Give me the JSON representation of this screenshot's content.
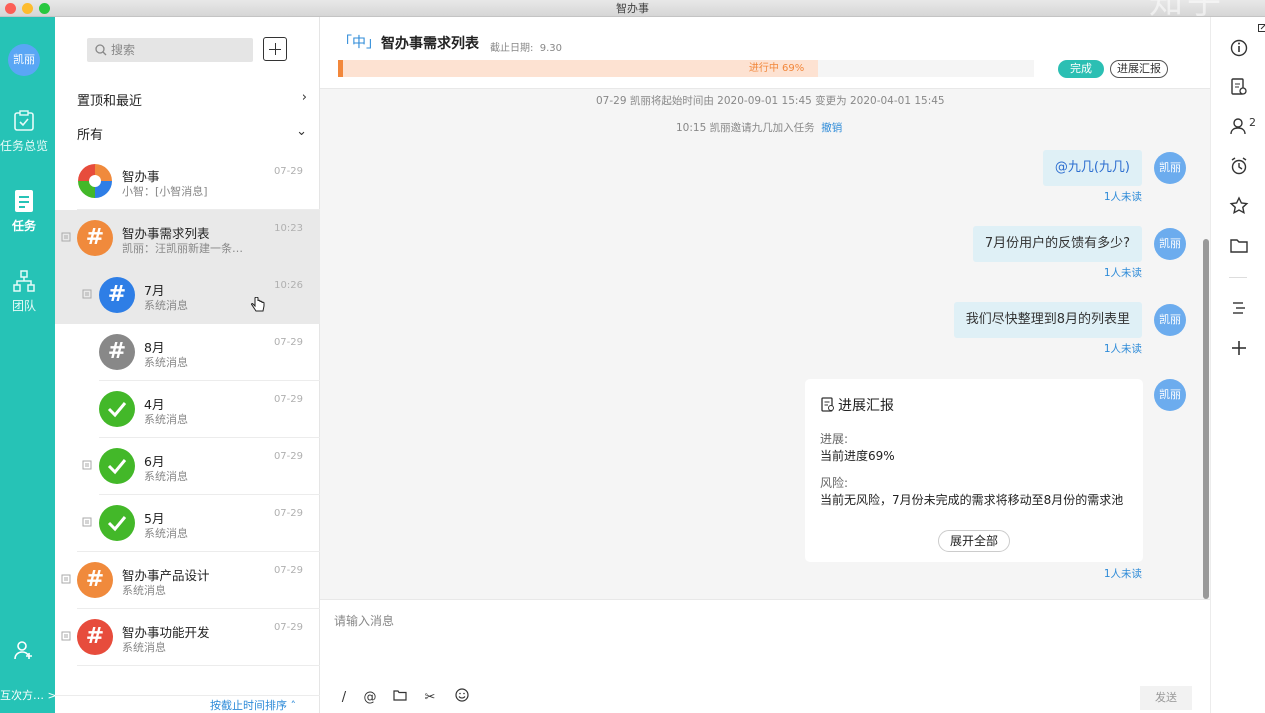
{
  "window": {
    "title": "智办事",
    "watermark": "知乎"
  },
  "nav": {
    "avatar": "凯丽",
    "items": [
      {
        "label": "任务总览",
        "icon": "task-overview-icon"
      },
      {
        "label": "任务",
        "icon": "task-icon"
      },
      {
        "label": "团队",
        "icon": "team-icon"
      }
    ],
    "bottom_label": "互次方…"
  },
  "list": {
    "search_placeholder": "搜索",
    "section_pinned": "置顶和最近",
    "section_all": "所有",
    "sort_label": "按截止时间排序",
    "items": [
      {
        "name": "智办事",
        "sub": "小智：[小智消息]",
        "time": "07-29",
        "color": "logo"
      },
      {
        "name": "智办事需求列表",
        "sub": "凯丽：汪凯丽新建一条…",
        "time": "10:23",
        "color": "#f08a3c"
      },
      {
        "name": "7月",
        "sub": "系统消息",
        "time": "10:26",
        "color": "#2e7ee6"
      },
      {
        "name": "8月",
        "sub": "系统消息",
        "time": "07-29",
        "color": "#888888"
      },
      {
        "name": "4月",
        "sub": "系统消息",
        "time": "07-29",
        "color": "#43b829"
      },
      {
        "name": "6月",
        "sub": "系统消息",
        "time": "07-29",
        "color": "#43b829"
      },
      {
        "name": "5月",
        "sub": "系统消息",
        "time": "07-29",
        "color": "#43b829"
      },
      {
        "name": "智办事产品设计",
        "sub": "系统消息",
        "time": "07-29",
        "color": "#f08a3c"
      },
      {
        "name": "智办事功能开发",
        "sub": "系统消息",
        "time": "07-29",
        "color": "#e74c3c"
      }
    ]
  },
  "chat": {
    "priority": "「中」",
    "title": "智办事需求列表",
    "deadline_label": "截止日期:",
    "deadline_value": "9.30",
    "progress_label": "进行中 69%",
    "progress_value": 0.69,
    "btn_done": "完成",
    "btn_report": "进展汇报",
    "system_messages": [
      {
        "text": "07-29  凯丽将起始时间由 2020-09-01 15:45 变更为 2020-04-01 15:45"
      },
      {
        "text": "10:15  凯丽邀请九几加入任务",
        "link": "撤销"
      }
    ],
    "messages": [
      {
        "text": "@九几(九几)",
        "avatar": "凯丽",
        "status": "1人未读"
      },
      {
        "text": "7月份用户的反馈有多少?",
        "avatar": "凯丽",
        "status": "1人未读"
      },
      {
        "text": "我们尽快整理到8月的列表里",
        "avatar": "凯丽",
        "status": "1人未读"
      }
    ],
    "report_card": {
      "title": "进展汇报",
      "progress_key": "进展:",
      "progress_value": "当前进度69%",
      "risk_key": "风险:",
      "risk_value": "当前无风险，7月份未完成的需求将移动至8月份的需求池",
      "expand": "展开全部",
      "avatar": "凯丽",
      "status": "1人未读"
    },
    "composer_placeholder": "请输入消息",
    "send": "发送"
  },
  "rbar": {
    "members_count": "2"
  },
  "colors": {
    "nav_bg": "#26c3b6",
    "accent": "#2e8bd8",
    "progress": "#f2873b"
  }
}
